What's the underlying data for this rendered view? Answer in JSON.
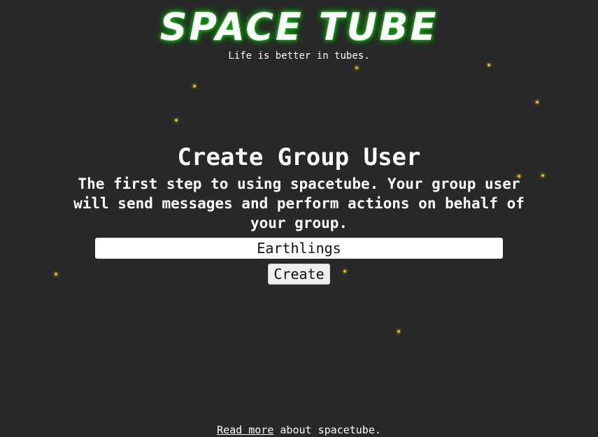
{
  "header": {
    "logo_text": "SPACE TUBE",
    "tagline": "Life is better in tubes."
  },
  "main": {
    "title": "Create Group User",
    "description": "The first step to using spacetube. Your group user will send messages and perform actions on behalf of your group.",
    "group_name_input": {
      "value": "Earthlings"
    },
    "create_button_label": "Create"
  },
  "footer": {
    "link_text": "Read more",
    "suffix_text": " about spacetube."
  },
  "decorations": {
    "star_glyph": "✷"
  },
  "colors": {
    "background": "#282828",
    "logo_glow": "#1aa81a",
    "star": "#f5d020",
    "text": "#ffffff"
  }
}
